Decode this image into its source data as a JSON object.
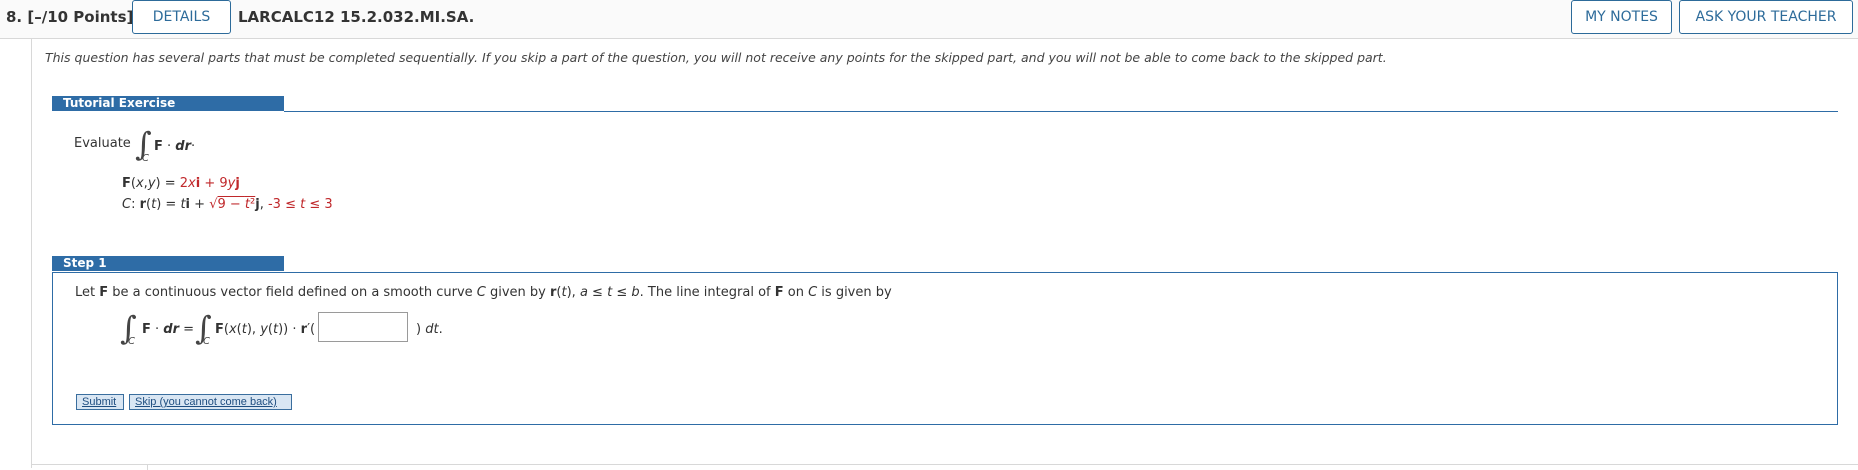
{
  "header": {
    "question_number": "8.",
    "points": "[–/10 Points]",
    "details_label": "DETAILS",
    "question_code": "LARCALC12 15.2.032.MI.SA.",
    "my_notes_label": "MY NOTES",
    "ask_teacher_label": "ASK YOUR TEACHER"
  },
  "notice": "This question has several parts that must be completed sequentially. If you skip a part of the question, you will not receive any points for the skipped part, and you will not be able to come back to the skipped part.",
  "tutorial": {
    "heading": "Tutorial Exercise",
    "evaluate_label": "Evaluate",
    "integral_sub": "C",
    "integrand": "F · dr·",
    "F_lhs": "F(x,y) = ",
    "F_rhs": "2xi + 9yj",
    "C_lhs": "C: r(t) = ti + ",
    "C_sqrt": "√9 − t²j",
    "C_range": ", -3 ≤ t ≤ 3"
  },
  "step1": {
    "heading": "Step 1",
    "description": "Let F be a continuous vector field defined on a smooth curve C given by r(t), a ≤ t ≤ b. The line integral of F on C is given by",
    "formula_lhs": "F · dr =",
    "formula_rhs": "F(x(t), y(t)) · r′(",
    "formula_tail": ") dt.",
    "integral_sub": "C",
    "answer_value": ""
  },
  "buttons": {
    "submit_label": "Submit",
    "skip_label": "Skip (you cannot come back)"
  }
}
